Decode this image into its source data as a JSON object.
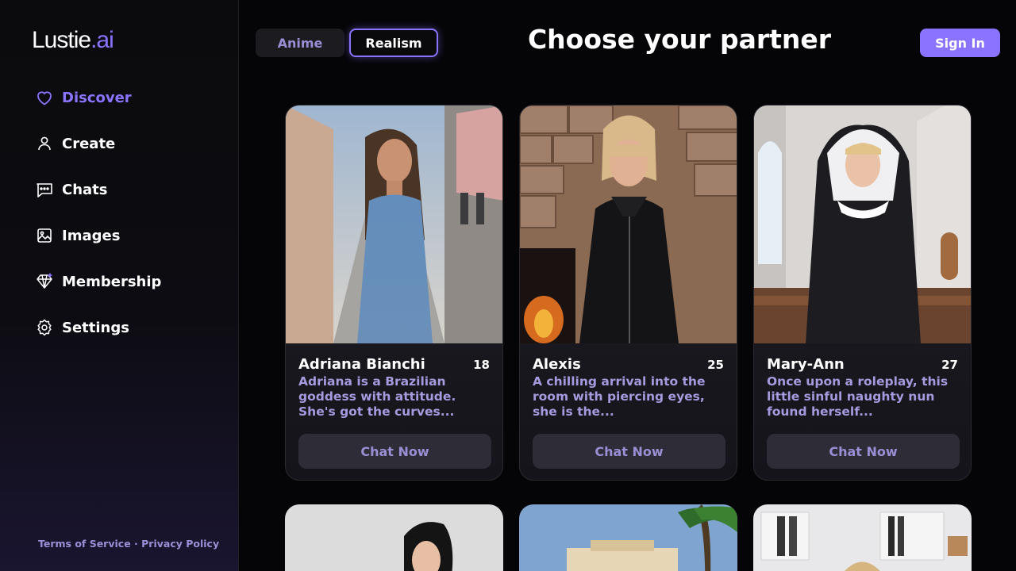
{
  "app": {
    "logo_main": "Lustie",
    "logo_accent": ".ai",
    "accent_color": "#8b73ff"
  },
  "sidebar": {
    "items": [
      {
        "label": "Discover",
        "icon": "heart-icon",
        "active": true
      },
      {
        "label": "Create",
        "icon": "user-icon",
        "active": false
      },
      {
        "label": "Chats",
        "icon": "chat-bubble-icon",
        "active": false
      },
      {
        "label": "Images",
        "icon": "image-icon",
        "active": false
      },
      {
        "label": "Membership",
        "icon": "diamond-icon",
        "active": false
      },
      {
        "label": "Settings",
        "icon": "gear-icon",
        "active": false
      }
    ],
    "footer": {
      "terms": "Terms of Service",
      "separator": " · ",
      "privacy": "Privacy Policy"
    }
  },
  "header": {
    "toggle": {
      "anime": "Anime",
      "realism": "Realism",
      "selected": "Realism"
    },
    "title": "Choose your partner",
    "sign_in": "Sign In"
  },
  "cards": [
    {
      "name": "Adriana Bianchi",
      "age": "18",
      "description": "Adriana is a Brazilian goddess with attitude. She's got the curves...",
      "button": "Chat Now"
    },
    {
      "name": "Alexis",
      "age": "25",
      "description": "A chilling arrival into the room with piercing eyes, she is the...",
      "button": "Chat Now"
    },
    {
      "name": "Mary-Ann",
      "age": "27",
      "description": "Once upon a roleplay, this little sinful naughty nun found herself...",
      "button": "Chat Now"
    }
  ]
}
